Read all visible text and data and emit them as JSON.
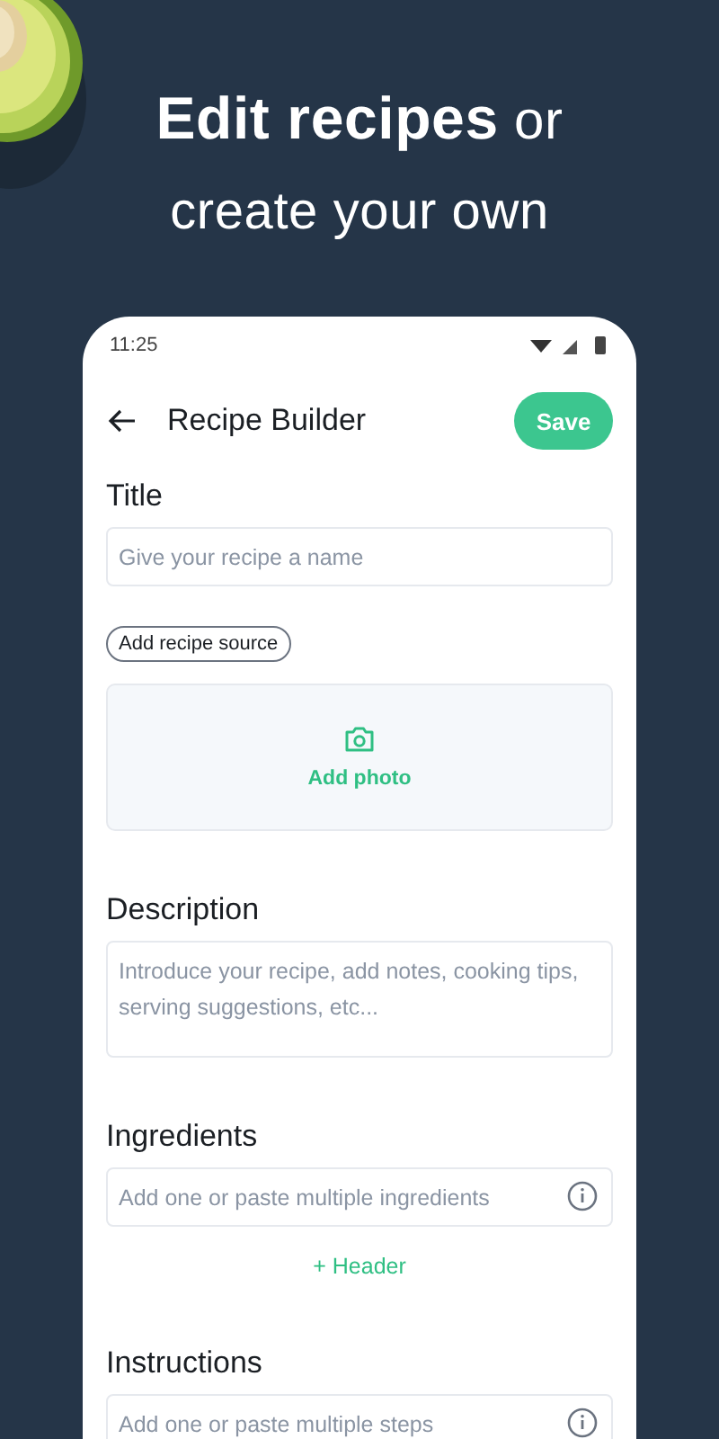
{
  "headline": [
    "**Edit recipes** or",
    "create your own"
  ],
  "status_bar": {
    "time": "11:25"
  },
  "header": {
    "title": "Recipe Builder",
    "save": "Save"
  },
  "sections": [
    {
      "kind": "input",
      "label": "Title",
      "placeholder": "Give your recipe a name"
    },
    {
      "kind": "chip",
      "text": "Add recipe source"
    },
    {
      "text": "Add photo"
    },
    {
      "kind": "textarea",
      "label": "Description",
      "placeholder": "Introduce your recipe, add notes, cooking tips, serving suggestions, etc..."
    },
    {
      "kind": "list",
      "label": "Ingredients",
      "placeholder": "Add one or paste multiple ingredients",
      "add": "+ Header"
    },
    {
      "kind": "list",
      "label": "Instructions",
      "placeholder": "Add one or paste multiple steps"
    }
  ]
}
